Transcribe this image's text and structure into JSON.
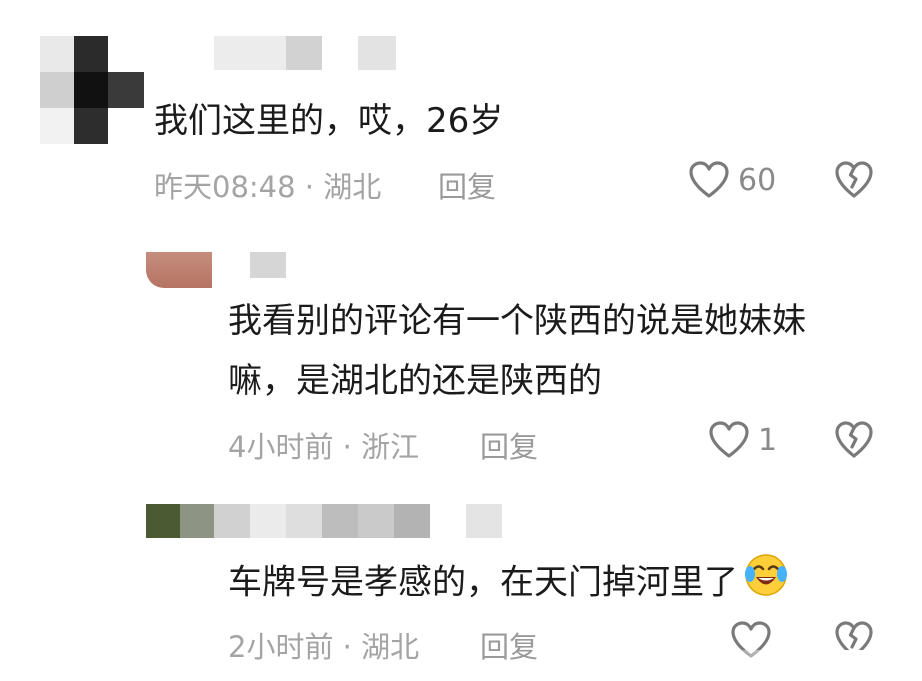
{
  "comments": [
    {
      "text": "我们这里的，哎，26岁",
      "time": "昨天08:48",
      "location": "湖北",
      "reply_label": "回复",
      "likes": "60"
    },
    {
      "text_line1": "我看别的评论有一个陕西的说是她妹妹",
      "text_line2": "嘛，是湖北的还是陕西的",
      "time": "4小时前",
      "location": "浙江",
      "reply_label": "回复",
      "likes": "1"
    },
    {
      "text": "车牌号是孝感的，在天门掉河里了",
      "emoji": "crying-laughing-emoji",
      "time": "2小时前",
      "location": "湖北",
      "reply_label": "回复"
    }
  ],
  "separator": " · ",
  "colors": {
    "meta": "#a4a4a4",
    "text": "#1b1b1b",
    "icon": "#7a7a7a"
  }
}
